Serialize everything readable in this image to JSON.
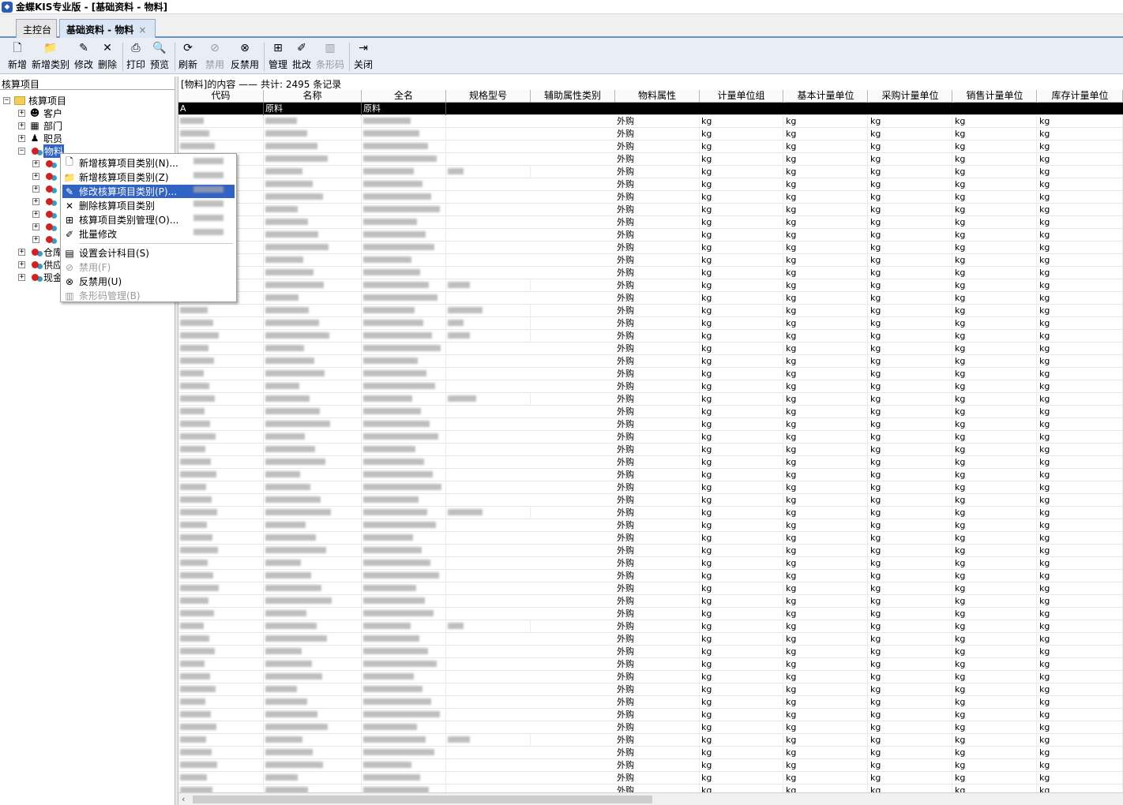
{
  "window": {
    "title": "金蝶KIS专业版 - [基础资料 - 物料]"
  },
  "tabs": [
    {
      "label": "主控台"
    },
    {
      "label": "基础资料 - 物料",
      "close": "×"
    }
  ],
  "toolbar": [
    {
      "id": "new",
      "label": "新增",
      "icon": "new-doc-icon",
      "glyph": "🗋",
      "enabled": true
    },
    {
      "id": "new-category",
      "label": "新增类别",
      "icon": "folder-icon",
      "glyph": "📁",
      "enabled": true
    },
    {
      "id": "edit",
      "label": "修改",
      "icon": "edit-icon",
      "glyph": "✎",
      "enabled": true
    },
    {
      "id": "delete",
      "label": "删除",
      "icon": "delete-icon",
      "glyph": "✕",
      "enabled": true
    },
    {
      "id": "print",
      "label": "打印",
      "icon": "printer-icon",
      "glyph": "⎙",
      "enabled": true
    },
    {
      "id": "preview",
      "label": "预览",
      "icon": "preview-icon",
      "glyph": "🔍",
      "enabled": true
    },
    {
      "id": "refresh",
      "label": "刷新",
      "icon": "refresh-icon",
      "glyph": "⟳",
      "enabled": true
    },
    {
      "id": "disable",
      "label": "禁用",
      "icon": "disable-icon",
      "glyph": "⊘",
      "enabled": false
    },
    {
      "id": "enable",
      "label": "反禁用",
      "icon": "enable-icon",
      "glyph": "⊗",
      "enabled": true
    },
    {
      "id": "manage",
      "label": "管理",
      "icon": "manage-icon",
      "glyph": "⊞",
      "enabled": true
    },
    {
      "id": "batch-edit",
      "label": "批改",
      "icon": "batch-edit-icon",
      "glyph": "✐",
      "enabled": true
    },
    {
      "id": "barcode",
      "label": "条形码",
      "icon": "barcode-icon",
      "glyph": "▥",
      "enabled": false
    },
    {
      "id": "close",
      "label": "关闭",
      "icon": "exit-door-icon",
      "glyph": "⇥",
      "enabled": true
    }
  ],
  "tree": {
    "header": "核算项目",
    "root": "核算项目",
    "items": [
      {
        "label": "客户",
        "icon": "customer-icon"
      },
      {
        "label": "部门",
        "icon": "department-icon"
      },
      {
        "label": "职员",
        "icon": "employee-icon"
      },
      {
        "label": "物料",
        "icon": "material-icon",
        "selected": true
      },
      {
        "label": "仓库",
        "icon": "warehouse-icon"
      },
      {
        "label": "供应",
        "icon": "supplier-icon"
      },
      {
        "label": "现金",
        "icon": "cash-icon"
      }
    ]
  },
  "context_menu": [
    {
      "label": "新增核算项目类别(N)...",
      "shortcut": "Ctrl+N",
      "icon": "new-doc-icon",
      "glyph": "🗋",
      "enabled": true,
      "highlight": false
    },
    {
      "label": "新增核算项目类别(Z)",
      "shortcut": "Ctrl+Z",
      "icon": "folder-icon",
      "glyph": "📁",
      "enabled": true,
      "highlight": false
    },
    {
      "label": "修改核算项目类别(P)...",
      "shortcut": "Ctrl+P",
      "icon": "edit-icon",
      "glyph": "✎",
      "enabled": true,
      "highlight": true
    },
    {
      "label": "删除核算项目类别",
      "shortcut": "Ctrl+D",
      "icon": "delete-icon",
      "glyph": "✕",
      "enabled": true,
      "highlight": false
    },
    {
      "label": "核算项目类别管理(O)...",
      "shortcut": "Ctrl+O",
      "icon": "manage-icon",
      "glyph": "⊞",
      "enabled": true,
      "highlight": false
    },
    {
      "label": "批量修改",
      "shortcut": "Ctrl+B",
      "icon": "batch-edit-icon",
      "glyph": "✐",
      "enabled": true,
      "highlight": false
    },
    {
      "separator": true
    },
    {
      "label": "设置会计科目(S)",
      "shortcut": "",
      "icon": "accounts-icon",
      "glyph": "▤",
      "enabled": true,
      "highlight": false
    },
    {
      "label": "禁用(F)",
      "shortcut": "",
      "icon": "disable-icon",
      "glyph": "⊘",
      "enabled": false,
      "highlight": false
    },
    {
      "label": "反禁用(U)",
      "shortcut": "",
      "icon": "enable-icon",
      "glyph": "⊗",
      "enabled": true,
      "highlight": false
    },
    {
      "label": "条形码管理(B)",
      "shortcut": "",
      "icon": "barcode-icon",
      "glyph": "▥",
      "enabled": false,
      "highlight": false
    }
  ],
  "grid": {
    "caption": "[物料]的内容 —— 共计: 2495 条记录",
    "columns": [
      "代码",
      "名称",
      "全名",
      "规格型号",
      "辅助属性类别",
      "物料属性",
      "计量单位组",
      "基本计量单位",
      "采购计量单位",
      "销售计量单位",
      "库存计量单位"
    ],
    "group_row": {
      "code": "A",
      "name": "原料",
      "fullname": "原料"
    },
    "row_values": {
      "attr": "外购",
      "unit": "kg"
    },
    "visible_rows": 54
  },
  "colors": {
    "selection": "#3163c5",
    "toolbar_bg": "#e9eef6",
    "tab_active": "#dbe6f5"
  }
}
